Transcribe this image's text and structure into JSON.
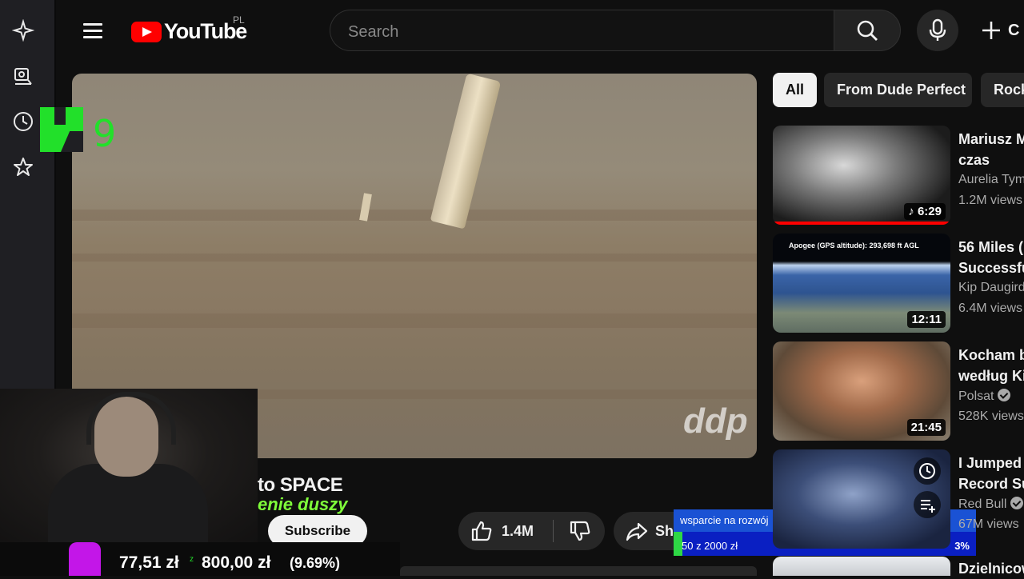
{
  "header": {
    "logo_text": "YouTube",
    "country_code": "PL",
    "search_placeholder": "Search",
    "create_label": "C"
  },
  "overlay": {
    "k9_digit": "9"
  },
  "video": {
    "title_fragment": "to SPACE",
    "channel_fragment": "enie duszy",
    "subscribe_label": "Subscribe",
    "likes": "1.4M",
    "share_label": "Share"
  },
  "donation": {
    "title": "wsparcie na rozwój",
    "amount": "50 z 2000 zł",
    "percent": "3%",
    "progress": 0.03,
    "colors": {
      "bar": "#0a1fc2",
      "fill": "#2ed845",
      "header": "#1a52d4"
    }
  },
  "ticker": {
    "amount": "77,51 zł",
    "separator": "z",
    "goal": "800,00 zł",
    "percent": "(9.69%)"
  },
  "chips": [
    "All",
    "From Dude Perfect",
    "Rock"
  ],
  "recommendations": [
    {
      "title": "Mariusz M",
      "title2": "czas",
      "channel": "Aurelia Tym",
      "views": "1.2M views",
      "duration": "6:29",
      "verified": false
    },
    {
      "title": "56 Miles (",
      "title2": "Successfu",
      "channel": "Kip Daugird",
      "views": "6.4M views",
      "duration": "12:11",
      "thumb_text": "Apogee (GPS altitude): 293,698 ft AGL",
      "verified": false
    },
    {
      "title": "Kocham b",
      "title2": "według Ki",
      "channel": "Polsat",
      "views": "528K views",
      "duration": "21:45",
      "verified": true
    },
    {
      "title": "I Jumped",
      "title2": "Record Su",
      "channel": "Red Bull",
      "views": "67M views",
      "duration": "",
      "verified": true
    },
    {
      "title": "Dzielnicow",
      "title2": "",
      "channel": "",
      "views": "",
      "duration": "",
      "verified": false
    }
  ],
  "colors": {
    "background": "#0f0f0f",
    "accent_red": "#ff0000",
    "k9_green": "#22e02a"
  }
}
